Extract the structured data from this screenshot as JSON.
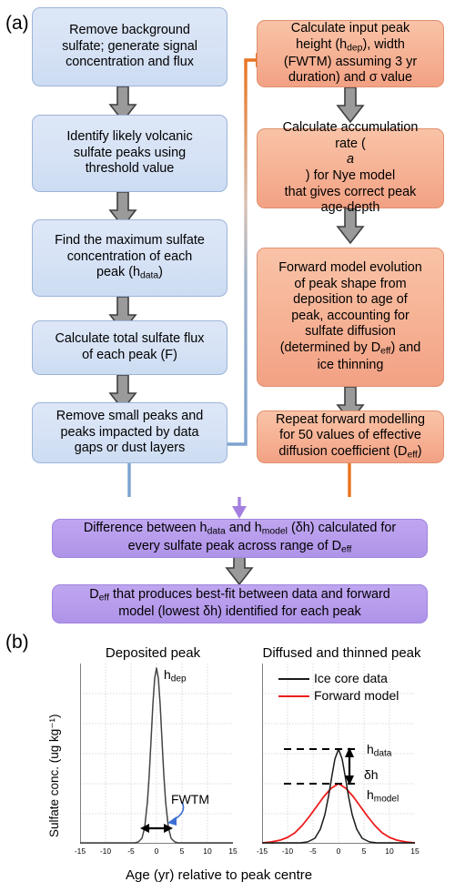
{
  "figure": {
    "panel_a_label": "(a)",
    "panel_b_label": "(b)"
  },
  "flowchart": {
    "blue_boxes": [
      {
        "id": "remove-background-sulfate",
        "lines": [
          "Remove background",
          "sulfate; generate signal",
          "concentration and flux"
        ]
      },
      {
        "id": "identify-volcanic-peaks",
        "lines": [
          "Identify likely volcanic",
          "sulfate peaks using",
          "threshold value"
        ]
      },
      {
        "id": "find-max-concentration",
        "lines": [
          "Find the maximum sulfate",
          "concentration of each",
          "peak (h_data)"
        ]
      },
      {
        "id": "calculate-total-flux",
        "lines": [
          "Calculate total sulfate flux",
          "of each peak (F)"
        ]
      },
      {
        "id": "remove-small-peaks",
        "lines": [
          "Remove small peaks and",
          "peaks impacted by data",
          "gaps or dust layers"
        ]
      }
    ],
    "orange_boxes": [
      {
        "id": "calculate-input-peak-height",
        "lines": [
          "Calculate input peak",
          "height (h_dep), width",
          "(FWTM) assuming 3 yr",
          "duration) and σ value"
        ]
      },
      {
        "id": "calculate-accumulation-rate",
        "lines": [
          "Calculate accumulation",
          "rate (a) for Nye model",
          "that gives correct peak",
          "age-depth"
        ]
      },
      {
        "id": "forward-model-evolution",
        "lines": [
          "Forward model evolution",
          "of peak shape from",
          "deposition to age of",
          "peak, accounting for",
          "sulfate diffusion",
          "(determined by D_eff) and",
          "ice thinning"
        ]
      },
      {
        "id": "repeat-forward-modelling",
        "lines": [
          "Repeat forward modelling",
          "for 50 values of effective",
          "diffusion coefficient (D_eff)"
        ]
      }
    ],
    "purple_boxes": [
      {
        "id": "difference-between-h",
        "lines": [
          "Difference between h_data and h_model (δh) calculated for",
          "every sulfate peak across range of D_eff"
        ]
      },
      {
        "id": "deff-best-fit",
        "lines": [
          "D_eff that produces best-fit between data and forward",
          "model (lowest δh) identified for each peak"
        ]
      }
    ],
    "colors": {
      "blue_fill": "#d6e2f5",
      "blue_border": "#9db4d8",
      "orange_fill": "#f6b194",
      "orange_border": "#e09070",
      "purple_fill": "#b79cec",
      "purple_border": "#9f85dd",
      "grey_arrow_fill": "#9a9a9a",
      "grey_arrow_border": "#3f3f3f",
      "connector_blue": "#7da3cf",
      "connector_orange": "#e8731f",
      "connector_purple": "#a57fe0"
    }
  },
  "chart_data": [
    {
      "type": "line",
      "id": "deposited-peak",
      "title": "Deposited peak",
      "xlabel": "Age (yr) relative to peak centre",
      "ylabel": "Sulfate conc. (ug kg⁻¹)",
      "xlim": [
        -15,
        15
      ],
      "ylim": [
        0,
        1.05
      ],
      "xticks": [
        -15,
        -10,
        -5,
        0,
        5,
        10,
        15
      ],
      "xticklabels": [
        "-15",
        "-10",
        "-5",
        "0",
        "5",
        "10",
        "15"
      ],
      "grid": true,
      "series": [
        {
          "name": "Deposited peak",
          "color": "#404040",
          "peak_centre": 0,
          "peak_height": 1.0,
          "sigma": 0.86,
          "style": "solid"
        }
      ],
      "annotations": [
        {
          "id": "h-dep-label",
          "text": "h",
          "sub": "dep",
          "x": 1.9,
          "y": 0.95
        },
        {
          "id": "fwtm-label",
          "text": "FWTM",
          "x": 4.2,
          "y": 0.22
        },
        {
          "id": "fwtm-arrow",
          "text": "",
          "note": "black double-headed horizontal arrow at base of peak spanning FWTM"
        },
        {
          "id": "fwtm-pointer",
          "text": "",
          "note": "blue curved pointer from FWTM label to peak base"
        }
      ]
    },
    {
      "type": "line",
      "id": "diffused-thinned-peak",
      "title": "Diffused and thinned peak",
      "xlabel": "Age (yr) relative to peak centre",
      "ylabel": "",
      "xlim": [
        -15,
        15
      ],
      "ylim": [
        0,
        1.05
      ],
      "xticks": [
        -15,
        -10,
        -5,
        0,
        5,
        10,
        15
      ],
      "xticklabels": [
        "-15",
        "-10",
        "-5",
        "0",
        "5",
        "10",
        "15"
      ],
      "grid": true,
      "legend": [
        {
          "label": "Ice core data",
          "color": "#1a1a1a"
        },
        {
          "label": "Forward model",
          "color": "#ee1b1b"
        }
      ],
      "series": [
        {
          "name": "Ice core data",
          "color": "#1a1a1a",
          "peak_centre": 0,
          "peak_height": 0.52,
          "sigma": 1.8,
          "style": "solid"
        },
        {
          "name": "Forward model",
          "color": "#ee1b1b",
          "peak_centre": 0,
          "peak_height": 0.33,
          "sigma": 4.2,
          "style": "solid"
        }
      ],
      "annotations": [
        {
          "id": "h-data-label",
          "text": "h",
          "sub": "data",
          "y_value": 0.52
        },
        {
          "id": "h-model-label",
          "text": "h",
          "sub": "model",
          "y_value": 0.33
        },
        {
          "id": "delta-h-label",
          "text": "δh"
        },
        {
          "id": "h-data-dashed-line",
          "text": "",
          "note": "black dashed horizontal line at h_data"
        },
        {
          "id": "h-model-dashed-line",
          "text": "",
          "note": "black dashed horizontal line at h_model"
        },
        {
          "id": "delta-h-arrow",
          "text": "",
          "note": "black double-headed vertical arrow between dashed lines"
        }
      ]
    }
  ]
}
